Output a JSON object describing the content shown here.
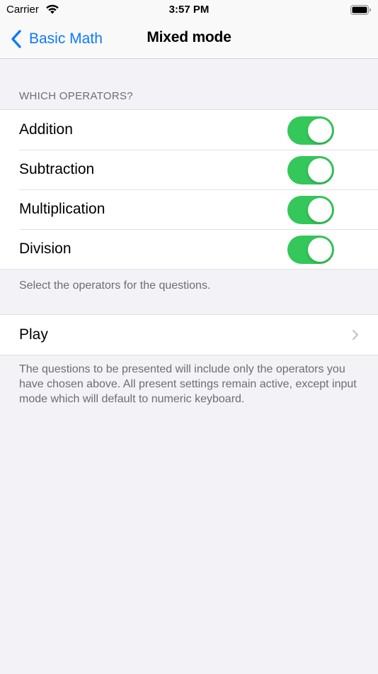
{
  "status_bar": {
    "carrier": "Carrier",
    "time": "3:57 PM"
  },
  "nav": {
    "back_label": "Basic Math",
    "title": "Mixed mode"
  },
  "operators": {
    "header": "WHICH OPERATORS?",
    "items": [
      {
        "label": "Addition",
        "enabled": true
      },
      {
        "label": "Subtraction",
        "enabled": true
      },
      {
        "label": "Multiplication",
        "enabled": true
      },
      {
        "label": "Division",
        "enabled": true
      }
    ],
    "footer": "Select the operators for the questions."
  },
  "play": {
    "label": "Play",
    "footer": "The questions to be presented will include only the operators you have chosen above. All present settings remain active, except input mode which will default to numeric keyboard."
  },
  "colors": {
    "accent": "#0a7aff",
    "toggle_on": "#34c759",
    "background": "#f2f2f7"
  },
  "icons": {
    "wifi": "wifi-icon",
    "battery": "battery-icon",
    "back": "chevron-left-icon",
    "disclosure": "chevron-right-icon"
  }
}
